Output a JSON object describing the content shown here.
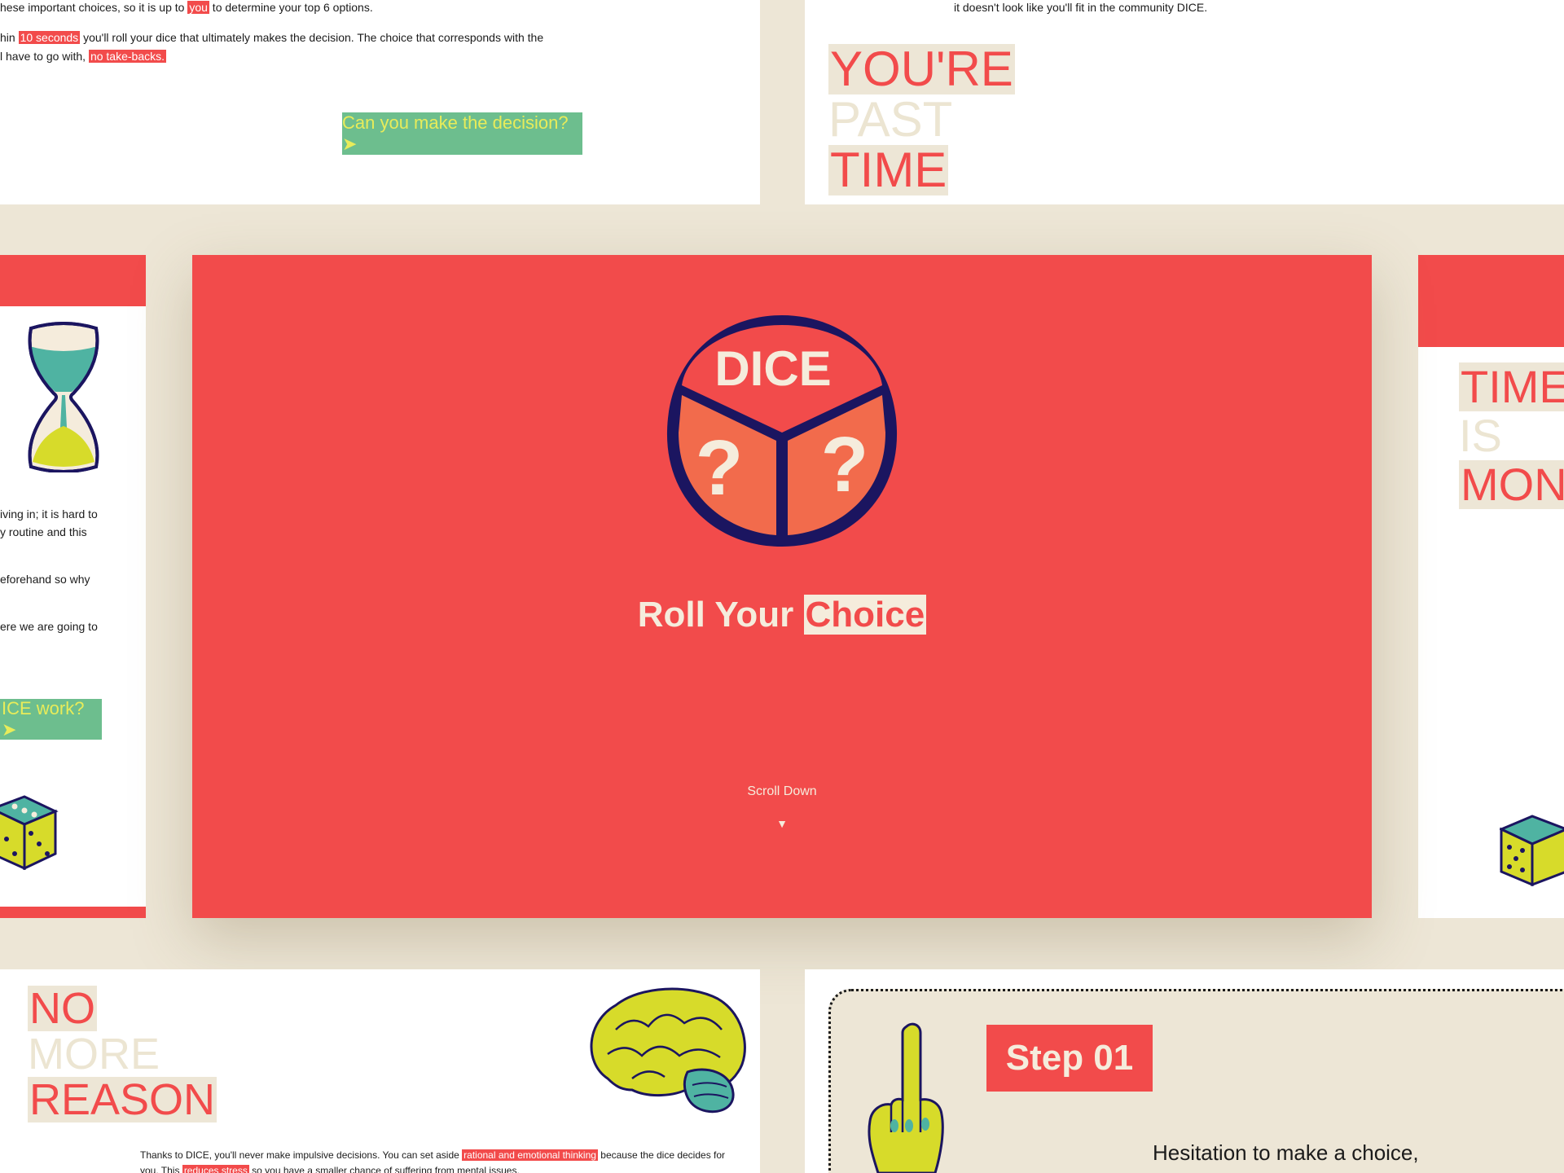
{
  "colors": {
    "page_bg": "#ede6d6",
    "brand_red": "#f24b4b",
    "button_green": "#6dbe8e",
    "button_text": "#e8ec5a",
    "dice_navy": "#1b1560",
    "dice_orange": "#f26b4c",
    "cream": "#f5ecdc"
  },
  "top_left": {
    "line1_pre": "hese important choices, so it is up to ",
    "line1_hl": "you",
    "line1_post": " to determine your top 6 options.",
    "line2_pre": "hin ",
    "line2_hl": "10 seconds",
    "line2_post": " you'll roll your dice that ultimately makes the decision. The choice that corresponds with the",
    "line3_pre": "l have to go with, ",
    "line3_hl": "no take-backs.",
    "button": "Can you make the decision? ➤"
  },
  "top_right": {
    "line": "it doesn't look like you'll fit in the community DICE.",
    "words": [
      "YOU'RE",
      "PAST",
      "TIME"
    ]
  },
  "left_card": {
    "icon": "hourglass-icon",
    "lines": [
      "iving in; it is hard to",
      "y routine and this",
      "eforehand so why",
      "ere we are going to"
    ],
    "button": "ICE work? ➤"
  },
  "right_card": {
    "words": [
      "TIME",
      "IS",
      "MON"
    ]
  },
  "hero": {
    "logo_text": "DICE",
    "logo_glyph": "?",
    "title_plain": "Roll Your",
    "title_highlight": "Choice",
    "scroll_label": "Scroll Down",
    "scroll_arrow": "▼"
  },
  "bottom_left": {
    "words": [
      "NO",
      "MORE",
      "REASON"
    ],
    "icon": "brain-icon",
    "para_pre": "Thanks to DICE, you'll never make impulsive decisions. You can set aside ",
    "para_hl": "rational and emotional thinking",
    "para_post": " because the dice decides for",
    "para2_pre": "you. This ",
    "para2_hl": "reduces stress",
    "para2_post": " so you have a smaller chance of suffering from mental issues."
  },
  "bottom_right": {
    "icon": "pointing-hand-icon",
    "step_label": "Step 01",
    "step_text": "Hesitation to make a choice,"
  }
}
